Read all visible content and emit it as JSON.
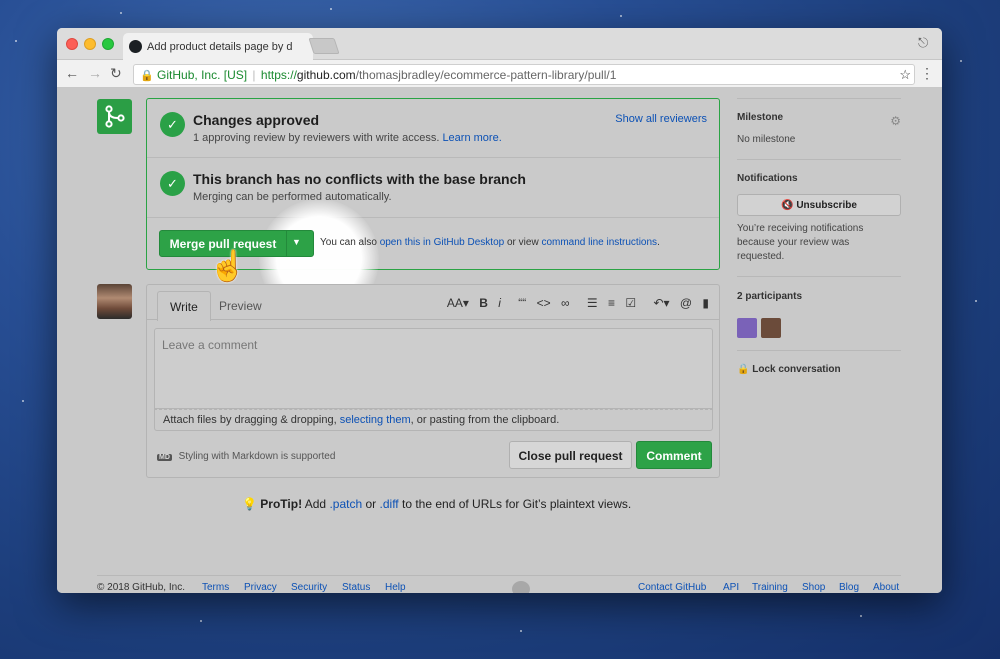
{
  "browser": {
    "tab_title": "Add product details page by d",
    "secure_label": "GitHub, Inc. [US]",
    "url_scheme": "https://",
    "url_host": "github.com",
    "url_path": "/thomasjbradley/ecommerce-pattern-library/pull/1"
  },
  "merge_box": {
    "approved": {
      "title": "Changes approved",
      "subtitle": "1 approving review by reviewers with write access.",
      "learn_more": "Learn more.",
      "show_all": "Show all reviewers"
    },
    "conflicts": {
      "title": "This branch has no conflicts with the base branch",
      "subtitle": "Merging can be performed automatically."
    },
    "merge_button": "Merge pull request",
    "also_prefix": "You can also",
    "desktop_link": "open this in GitHub Desktop",
    "or_view": "or view",
    "cli_link": "command line instructions",
    "period": "."
  },
  "comment": {
    "tab_write": "Write",
    "tab_preview": "Preview",
    "placeholder": "Leave a comment",
    "attach_prefix": "Attach files by dragging & dropping,",
    "attach_link": "selecting them",
    "attach_suffix": ", or pasting from the clipboard.",
    "markdown_badge": "MD",
    "markdown_note": "Styling with Markdown is supported",
    "close_button": "Close pull request",
    "comment_button": "Comment",
    "toolbar": [
      "AA▾",
      "B",
      "i",
      "““",
      "<>",
      "∞",
      "☰",
      "≡",
      "☑",
      "↶▾",
      "@",
      "▮"
    ]
  },
  "protip": {
    "label": "ProTip!",
    "text_1": "Add",
    "patch": ".patch",
    "or": "or",
    "diff": ".diff",
    "text_2": "to the end of URLs for Git’s plaintext views."
  },
  "sidebar": {
    "milestone_heading": "Milestone",
    "milestone_value": "No milestone",
    "notifications_heading": "Notifications",
    "unsubscribe": "Unsubscribe",
    "notifications_text": "You’re receiving notifications because your review was requested.",
    "participants_heading": "2 participants",
    "lock": "Lock conversation"
  },
  "footer": {
    "copyright": "© 2018 GitHub, Inc.",
    "left_links": [
      "Terms",
      "Privacy",
      "Security",
      "Status",
      "Help"
    ],
    "right_links": [
      "Contact GitHub",
      "API",
      "Training",
      "Shop",
      "Blog",
      "About"
    ]
  },
  "colors": {
    "accent_green": "#2da247",
    "link_blue": "#0c51b5"
  }
}
